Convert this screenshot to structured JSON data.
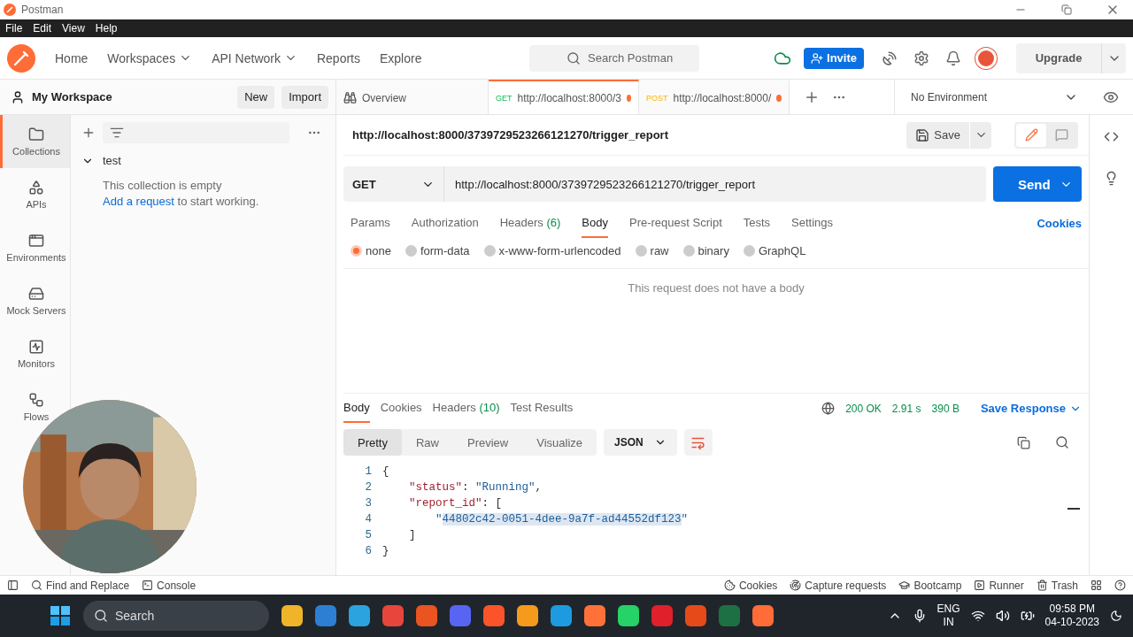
{
  "window": {
    "title": "Postman"
  },
  "menu": [
    "File",
    "Edit",
    "View",
    "Help"
  ],
  "nav": [
    {
      "label": "Home",
      "has_menu": false
    },
    {
      "label": "Workspaces",
      "has_menu": true
    },
    {
      "label": "API Network",
      "has_menu": true
    },
    {
      "label": "Reports",
      "has_menu": false
    },
    {
      "label": "Explore",
      "has_menu": false
    }
  ],
  "search": {
    "placeholder": "Search Postman"
  },
  "invite": "Invite",
  "upgrade": "Upgrade",
  "workspace": {
    "name": "My Workspace",
    "new": "New",
    "import": "Import"
  },
  "rail": [
    {
      "label": "Collections",
      "kind": "collections",
      "selected": true
    },
    {
      "label": "APIs",
      "kind": "apis",
      "selected": false
    },
    {
      "label": "Environments",
      "kind": "environments",
      "selected": false
    },
    {
      "label": "Mock Servers",
      "kind": "mock",
      "selected": false
    },
    {
      "label": "Monitors",
      "kind": "monitors",
      "selected": false
    },
    {
      "label": "Flows",
      "kind": "flows",
      "selected": false
    }
  ],
  "collections": [
    {
      "name": "test",
      "expanded": true,
      "empty_text": "This collection is empty",
      "link": "Add a request",
      "after_link": " to start working."
    }
  ],
  "tabs": [
    {
      "kind": "overview",
      "label": "Overview",
      "selected": false
    },
    {
      "kind": "request",
      "method": "GET",
      "label": "http://localhost:8000/3",
      "selected": true,
      "unsaved": true
    },
    {
      "kind": "request",
      "method": "POST",
      "label": "http://localhost:8000/",
      "selected": false,
      "unsaved": true
    }
  ],
  "environment": "No Environment",
  "request": {
    "title": "http://localhost:8000/3739729523266121270/trigger_report",
    "save": "Save",
    "method": "GET",
    "url": "http://localhost:8000/3739729523266121270/trigger_report",
    "send": "Send",
    "tabs": [
      {
        "label": "Params",
        "selected": false
      },
      {
        "label": "Authorization",
        "selected": false
      },
      {
        "label": "Headers",
        "badge": "(6)",
        "selected": false
      },
      {
        "label": "Body",
        "selected": true
      },
      {
        "label": "Pre-request Script",
        "selected": false
      },
      {
        "label": "Tests",
        "selected": false
      },
      {
        "label": "Settings",
        "selected": false
      }
    ],
    "cookies": "Cookies",
    "body_types": [
      {
        "label": "none",
        "selected": true
      },
      {
        "label": "form-data",
        "selected": false
      },
      {
        "label": "x-www-form-urlencoded",
        "selected": false
      },
      {
        "label": "raw",
        "selected": false
      },
      {
        "label": "binary",
        "selected": false
      },
      {
        "label": "GraphQL",
        "selected": false
      }
    ],
    "empty_body": "This request does not have a body"
  },
  "response": {
    "tabs": [
      {
        "label": "Body",
        "selected": true
      },
      {
        "label": "Cookies",
        "selected": false
      },
      {
        "label": "Headers",
        "badge": "(10)",
        "selected": false
      },
      {
        "label": "Test Results",
        "selected": false
      }
    ],
    "stats": [
      "200 OK",
      "2.91 s",
      "390 B"
    ],
    "save": "Save Response",
    "views": [
      {
        "label": "Pretty",
        "selected": true
      },
      {
        "label": "Raw",
        "selected": false
      },
      {
        "label": "Preview",
        "selected": false
      },
      {
        "label": "Visualize",
        "selected": false
      }
    ],
    "format": "JSON",
    "lines": [
      {
        "number": "1",
        "tokens": [
          {
            "kind": "punct",
            "text": "{"
          }
        ],
        "children": [
          {
            "number": "2",
            "tokens": [
              {
                "kind": "key",
                "text": "\"status\""
              },
              {
                "kind": "punct",
                "text": ": "
              },
              {
                "kind": "string",
                "text": "\"Running\""
              },
              {
                "kind": "punct",
                "text": ","
              }
            ]
          },
          {
            "number": "3",
            "tokens": [
              {
                "kind": "key",
                "text": "\"report_id\""
              },
              {
                "kind": "punct",
                "text": ": ["
              }
            ],
            "children": [
              {
                "number": "4",
                "tokens": [
                  {
                    "kind": "string",
                    "text": "\""
                  },
                  {
                    "kind": "highlight",
                    "text": "44802c42-0051-4dee-9a7f-ad44552df123"
                  },
                  {
                    "kind": "string",
                    "text": "\""
                  }
                ]
              }
            ]
          },
          {
            "number": "5",
            "tokens": [
              {
                "kind": "punct",
                "text": "]"
              }
            ]
          }
        ]
      },
      {
        "number": "6",
        "tokens": [
          {
            "kind": "punct",
            "text": "}"
          }
        ]
      }
    ]
  },
  "status_bar": {
    "left": [
      {
        "kind": "search",
        "label": "Find and Replace"
      },
      {
        "kind": "console",
        "label": "Console"
      }
    ],
    "right": [
      {
        "kind": "cookie",
        "label": "Cookies"
      },
      {
        "kind": "capture",
        "label": "Capture requests"
      },
      {
        "kind": "bootcamp",
        "label": "Bootcamp"
      },
      {
        "kind": "runner",
        "label": "Runner"
      },
      {
        "kind": "trash",
        "label": "Trash"
      }
    ]
  },
  "taskbar": {
    "search": "Search",
    "apps": [
      {
        "color": "#f0b429"
      },
      {
        "color": "#2d7fd3"
      },
      {
        "color": "#2aa3df"
      },
      {
        "color": "#e8453c"
      },
      {
        "color": "#e95420"
      },
      {
        "color": "#5865f2"
      },
      {
        "color": "#fb542b"
      },
      {
        "color": "#f49b1b"
      },
      {
        "color": "#1e9be0"
      },
      {
        "color": "#ff7139"
      },
      {
        "color": "#25d366"
      },
      {
        "color": "#e0202b"
      },
      {
        "color": "#e64a19"
      },
      {
        "color": "#1d7044"
      },
      {
        "color": "#ff6c37"
      }
    ],
    "lang": "ENG",
    "region": "IN",
    "time": "09:58 PM",
    "date": "04-10-2023"
  }
}
